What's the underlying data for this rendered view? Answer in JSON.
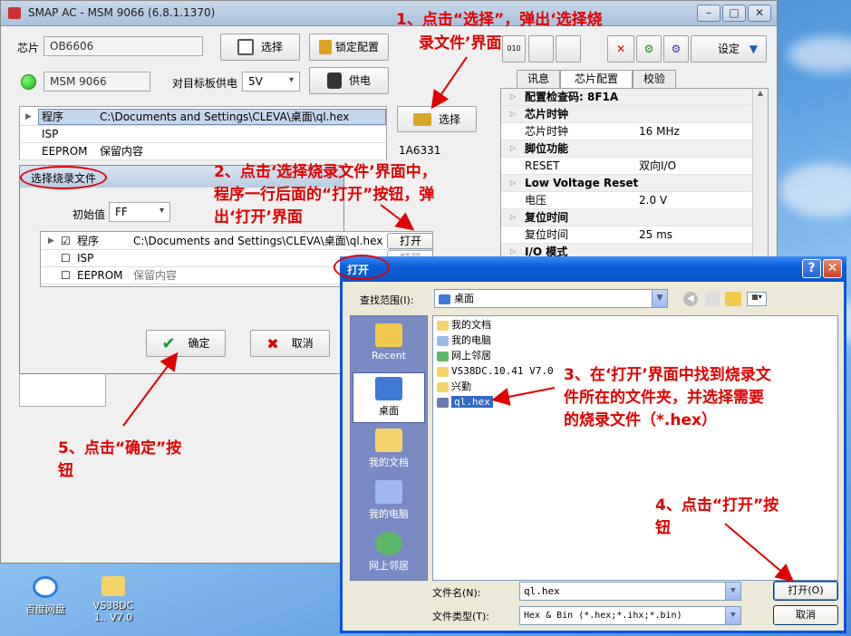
{
  "main": {
    "title": "SMAP AC - MSM 9066  (6.8.1.1370)",
    "chip_label": "芯片",
    "chip_value": "OB6606",
    "device_value": "MSM 9066",
    "target_supply_label": "对目标板供电",
    "voltage_value": "5V",
    "select_btn": "选择",
    "lock_btn": "锁定配置",
    "power_btn": "供电",
    "settings_btn": "设定",
    "select_file_btn": "选择",
    "checksum": "1A6331",
    "grid_rows": [
      {
        "name": "程序",
        "value": "C:\\Documents and Settings\\CLEVA\\桌面\\ql.hex"
      },
      {
        "name": "ISP",
        "value": ""
      },
      {
        "name": "EEPROM",
        "value": "保留内容"
      }
    ],
    "tabs": [
      "讯息",
      "芯片配置",
      "校验"
    ],
    "props": [
      {
        "k": "配置检查码: 8F1A",
        "v": "",
        "cat": true
      },
      {
        "k": "芯片时钟",
        "v": "",
        "cat": true
      },
      {
        "k": "芯片时钟",
        "v": "16 MHz",
        "cat": false
      },
      {
        "k": "脚位功能",
        "v": "",
        "cat": true
      },
      {
        "k": "RESET",
        "v": "双向I/O",
        "cat": false
      },
      {
        "k": "Low Voltage Reset",
        "v": "",
        "cat": true
      },
      {
        "k": "电压",
        "v": "2.0 V",
        "cat": false
      },
      {
        "k": "复位时间",
        "v": "",
        "cat": true
      },
      {
        "k": "复位时间",
        "v": "25 ms",
        "cat": false
      },
      {
        "k": "I/O 模式",
        "v": "",
        "cat": true
      }
    ]
  },
  "select_dialog": {
    "title": "选择烧录文件",
    "init_label": "初始值",
    "init_value": "FF",
    "rows": [
      {
        "name": "程序",
        "value": "C:\\Documents and Settings\\CLEVA\\桌面\\ql.hex",
        "checked": "☑"
      },
      {
        "name": "ISP",
        "value": "",
        "checked": "☐"
      },
      {
        "name": "EEPROM",
        "value": "保留内容",
        "checked": "☐"
      }
    ],
    "open_btn": "打开",
    "open_btn2": "打开",
    "ok_btn": "确定",
    "cancel_btn": "取消"
  },
  "open_dialog": {
    "title": "打开",
    "lookin_label": "查找范围(I):",
    "lookin_value": "桌面",
    "places": [
      "Recent",
      "桌面",
      "我的文档",
      "我的电脑",
      "网上邻居"
    ],
    "files": [
      "我的文档",
      "我的电脑",
      "网上邻居",
      "VS38DC.10.41 V7.0",
      "兴勤",
      "ql.hex"
    ],
    "filename_label": "文件名(N):",
    "filename_value": "ql.hex",
    "filetype_label": "文件类型(T):",
    "filetype_value": "Hex & Bin (*.hex;*.ihx;*.bin)",
    "open_btn": "打开(O)",
    "cancel_btn": "取消"
  },
  "annotations": {
    "step1a": "1、点击“选择”，弹出‘选择烧",
    "step1b": "录文件’界面",
    "step2a": "2、点击‘选择烧录文件’界面中，",
    "step2b": "程序一行后面的“打开”按钮，弹",
    "step2c": "出‘打开’界面",
    "step3a": "3、在‘打开’界面中找到烧录文",
    "step3b": "件所在的文件夹，并选择需要",
    "step3c": "的烧录文件（*.hex）",
    "step4a": "4、点击“打开”按",
    "step4b": "钮",
    "step5a": "5、点击“确定”按",
    "step5b": "钮"
  },
  "desktop": {
    "icon1": "百度网盘",
    "icon2": "VS38DC 1.. V7.0",
    "edge": "0"
  },
  "colors": {
    "accent_red": "#e00000",
    "xp_blue": "#0054e3"
  }
}
